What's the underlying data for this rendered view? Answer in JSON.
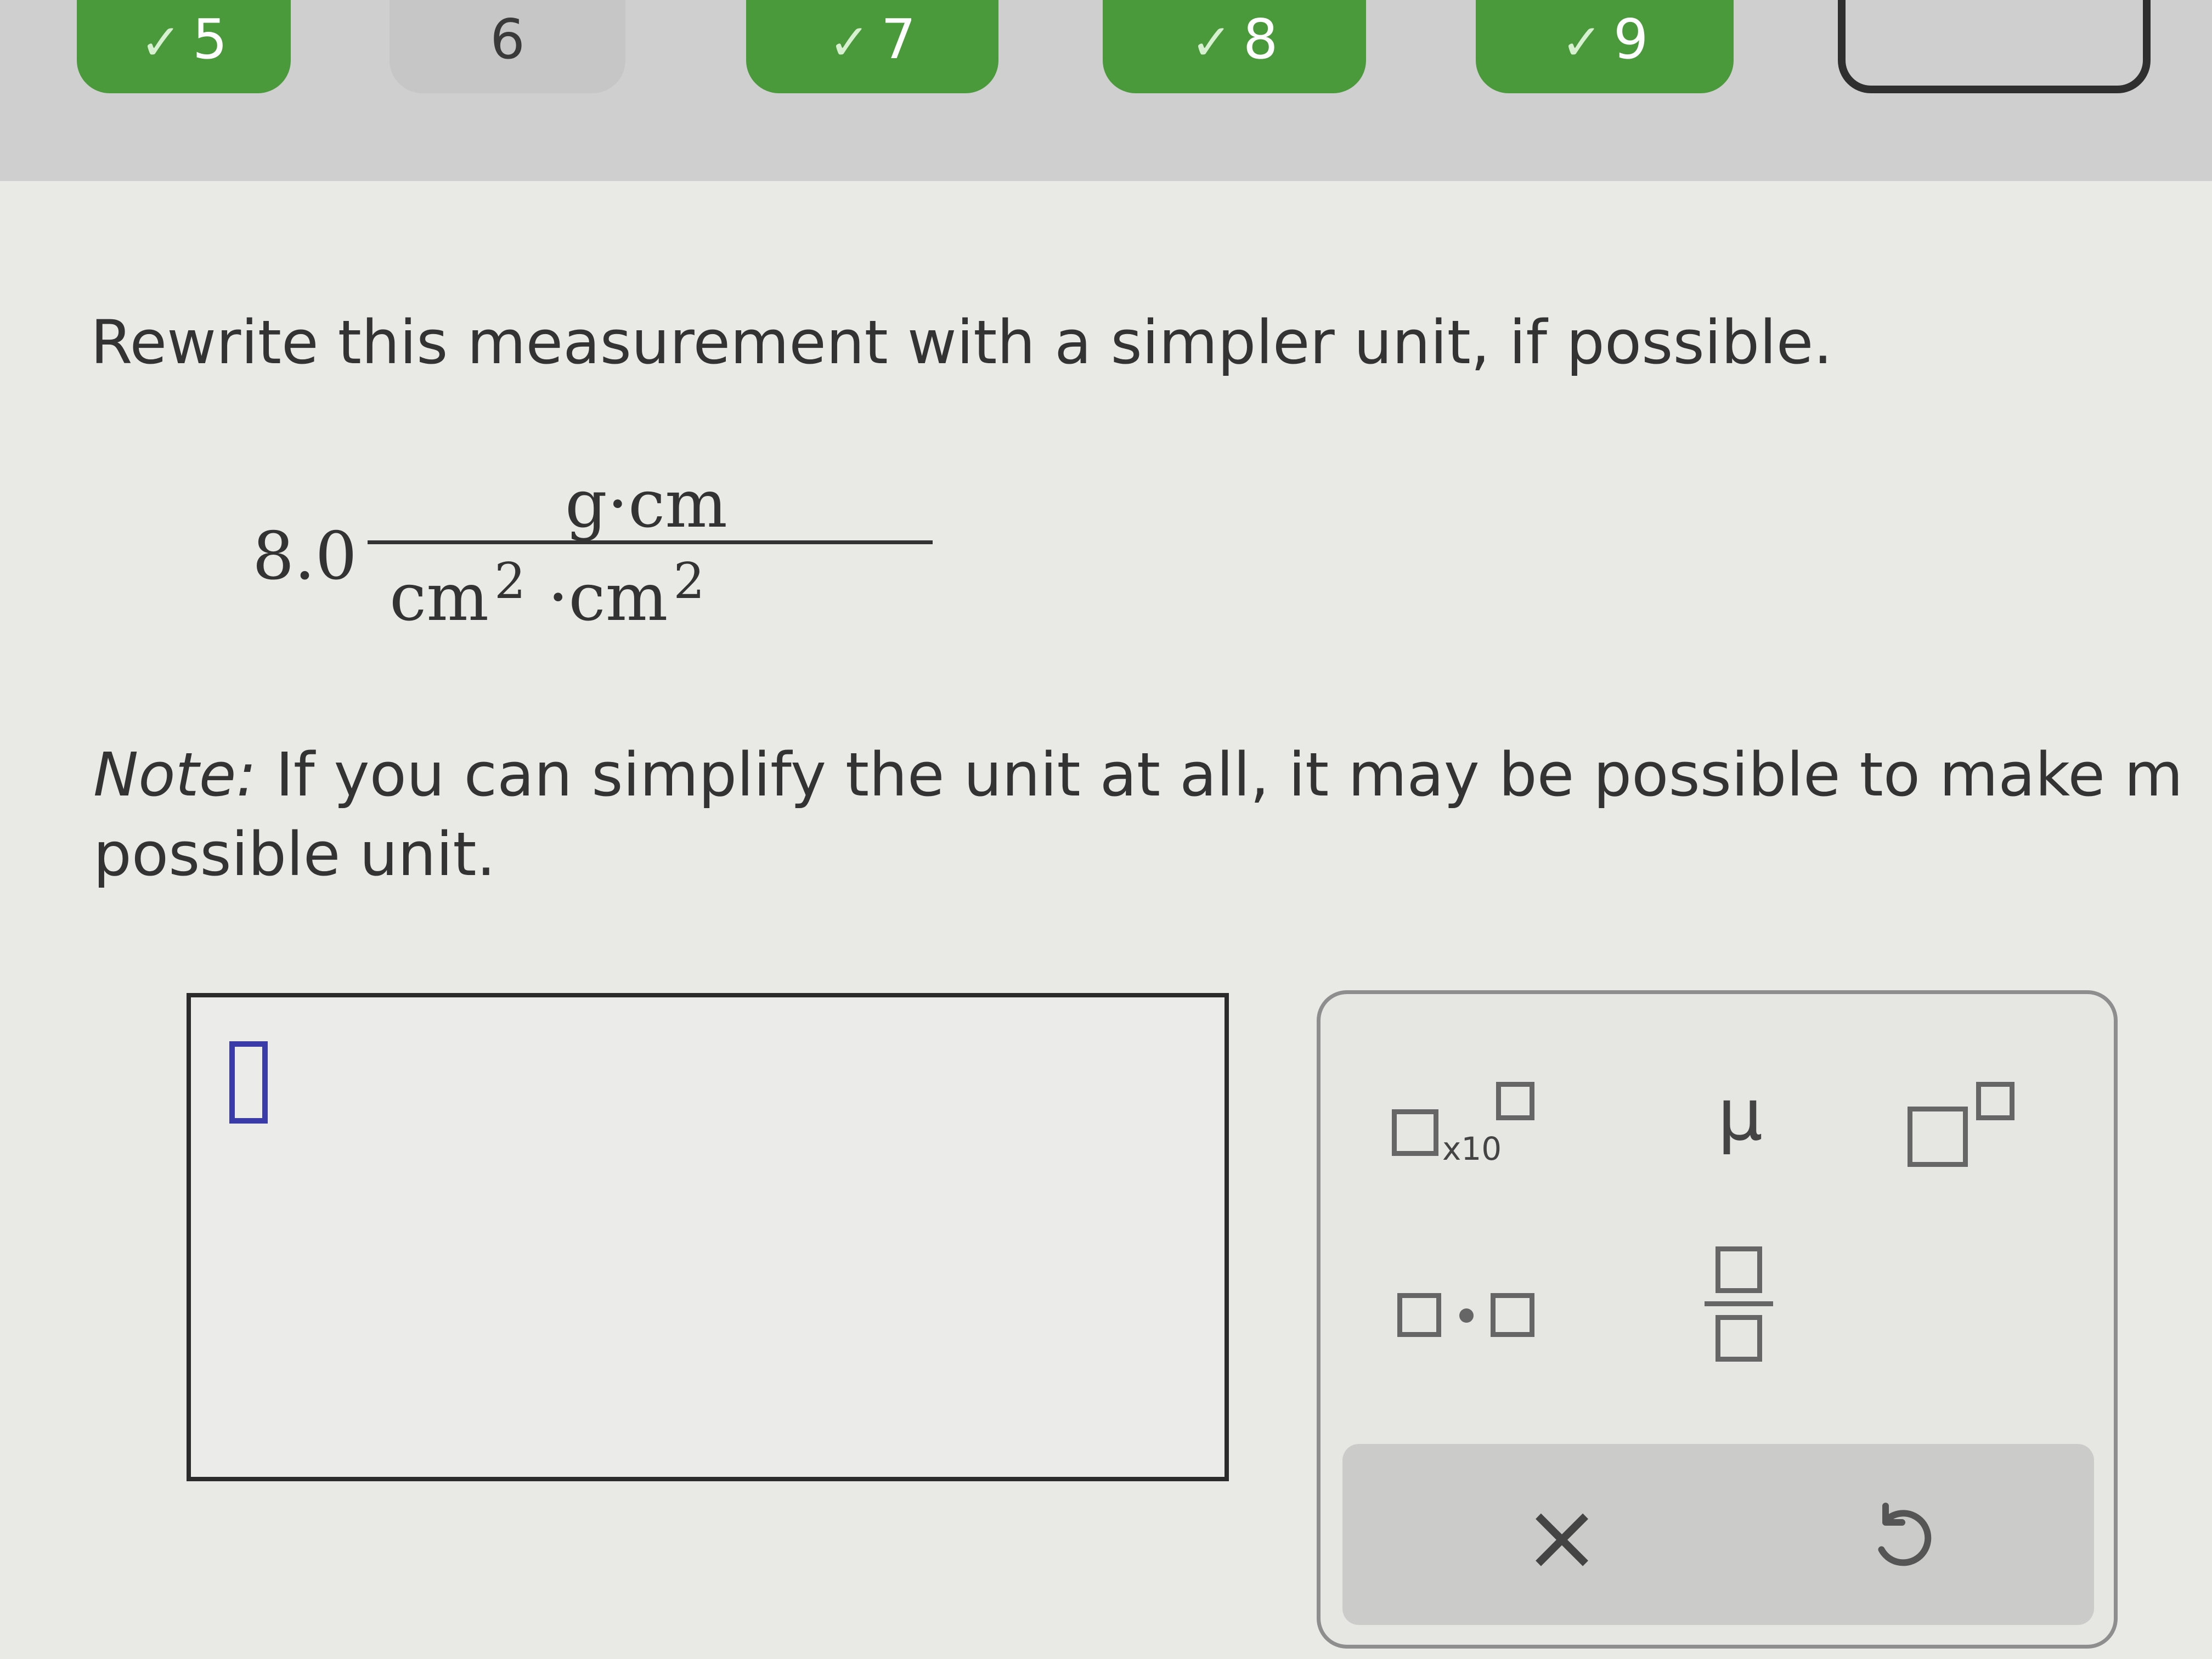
{
  "steps": [
    {
      "label": "5",
      "state": "done"
    },
    {
      "label": "6",
      "state": "todo"
    },
    {
      "label": "7",
      "state": "done"
    },
    {
      "label": "8",
      "state": "done"
    },
    {
      "label": "9",
      "state": "done"
    },
    {
      "label": "",
      "state": "outline"
    }
  ],
  "question": {
    "prompt": "Rewrite this measurement with a simpler unit, if possible.",
    "measurement": {
      "value": "8.0",
      "numerator": "g·cm",
      "denominator_unit1": "cm",
      "denominator_exp1": "2",
      "denominator_sep": "·",
      "denominator_unit2": "cm",
      "denominator_exp2": "2"
    },
    "note_label": "Note:",
    "note_text": " If you can simplify the unit at all, it may be possible to make m",
    "note_line2": "possible unit."
  },
  "keypad": {
    "sci_label": "x10",
    "mu_label": "μ",
    "clear_label": "×"
  },
  "colors": {
    "step_done": "#4a9a3c",
    "cursor": "#3a3aa8"
  }
}
